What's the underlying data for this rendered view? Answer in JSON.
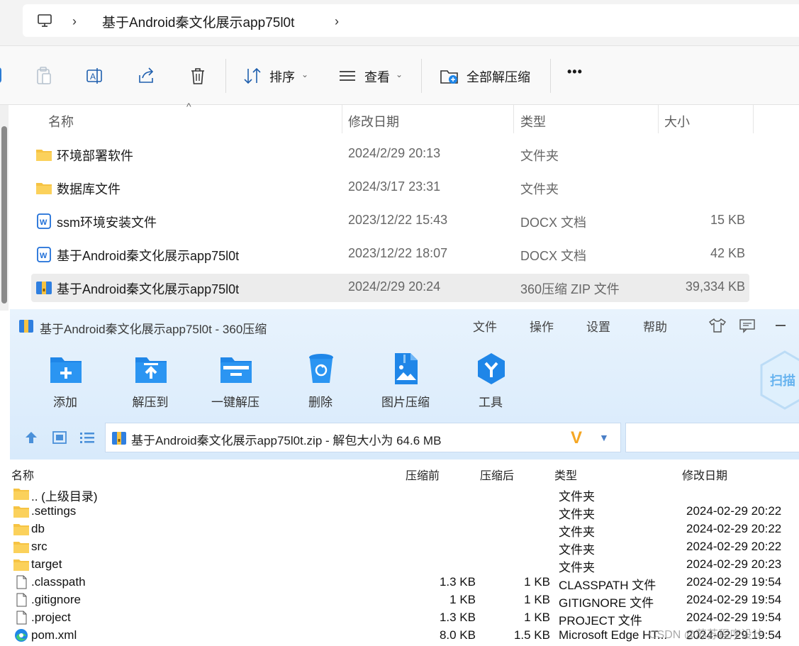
{
  "explorer": {
    "breadcrumb": "基于Android秦文化展示app75l0t",
    "commands": {
      "sort_label": "排序",
      "view_label": "查看",
      "extract_all_label": "全部解压缩",
      "more_label": "•••"
    },
    "columns": {
      "name": "名称",
      "date": "修改日期",
      "type": "类型",
      "size": "大小"
    },
    "files": [
      {
        "name": "环境部署软件",
        "date": "2024/2/29 20:13",
        "type": "文件夹",
        "size": "",
        "icon": "folder-icon"
      },
      {
        "name": "数据库文件",
        "date": "2024/3/17 23:31",
        "type": "文件夹",
        "size": "",
        "icon": "folder-icon"
      },
      {
        "name": "ssm环境安装文件",
        "date": "2023/12/22 15:43",
        "type": "DOCX 文档",
        "size": "15 KB",
        "icon": "docx-icon"
      },
      {
        "name": "基于Android秦文化展示app75l0t",
        "date": "2023/12/22 18:07",
        "type": "DOCX 文档",
        "size": "42 KB",
        "icon": "docx-icon"
      },
      {
        "name": "基于Android秦文化展示app75l0t",
        "date": "2024/2/29 20:24",
        "type": "360压缩 ZIP 文件",
        "size": "39,334 KB",
        "icon": "zip-icon"
      }
    ]
  },
  "archive": {
    "title": "基于Android秦文化展示app75l0t - 360压缩",
    "menu": [
      "文件",
      "操作",
      "设置",
      "帮助"
    ],
    "tools": [
      "添加",
      "解压到",
      "一键解压",
      "删除",
      "图片压缩",
      "工具"
    ],
    "scan_label": "扫描",
    "path": "基于Android秦文化展示app75l0t.zip - 解包大小为 64.6 MB",
    "columns": {
      "name": "名称",
      "pre": "压缩前",
      "post": "压缩后",
      "type": "类型",
      "date": "修改日期"
    },
    "rows": [
      {
        "name": ".. (上级目录)",
        "pre": "",
        "post": "",
        "type": "文件夹",
        "date": "",
        "icon": "folder-icon"
      },
      {
        "name": ".settings",
        "pre": "",
        "post": "",
        "type": "文件夹",
        "date": "2024-02-29 20:22",
        "icon": "folder-icon"
      },
      {
        "name": "db",
        "pre": "",
        "post": "",
        "type": "文件夹",
        "date": "2024-02-29 20:22",
        "icon": "folder-icon"
      },
      {
        "name": "src",
        "pre": "",
        "post": "",
        "type": "文件夹",
        "date": "2024-02-29 20:22",
        "icon": "folder-icon"
      },
      {
        "name": "target",
        "pre": "",
        "post": "",
        "type": "文件夹",
        "date": "2024-02-29 20:23",
        "icon": "folder-icon"
      },
      {
        "name": ".classpath",
        "pre": "1.3 KB",
        "post": "1 KB",
        "type": "CLASSPATH 文件",
        "date": "2024-02-29 19:54",
        "icon": "file-icon"
      },
      {
        "name": ".gitignore",
        "pre": "1 KB",
        "post": "1 KB",
        "type": "GITIGNORE 文件",
        "date": "2024-02-29 19:54",
        "icon": "file-icon"
      },
      {
        "name": ".project",
        "pre": "1.3 KB",
        "post": "1 KB",
        "type": "PROJECT 文件",
        "date": "2024-02-29 19:54",
        "icon": "file-icon"
      },
      {
        "name": "pom.xml",
        "pre": "8.0 KB",
        "post": "1.5 KB",
        "type": "Microsoft Edge HT...",
        "date": "2024-02-29 19:54",
        "icon": "edge-icon"
      }
    ]
  },
  "watermark": "CSDN @苏苏程序设计",
  "colors": {
    "folder": "#f6c343",
    "accent_blue": "#1f86e8",
    "zip_header_bg": "#dcecfb",
    "selection": "#ececec"
  }
}
